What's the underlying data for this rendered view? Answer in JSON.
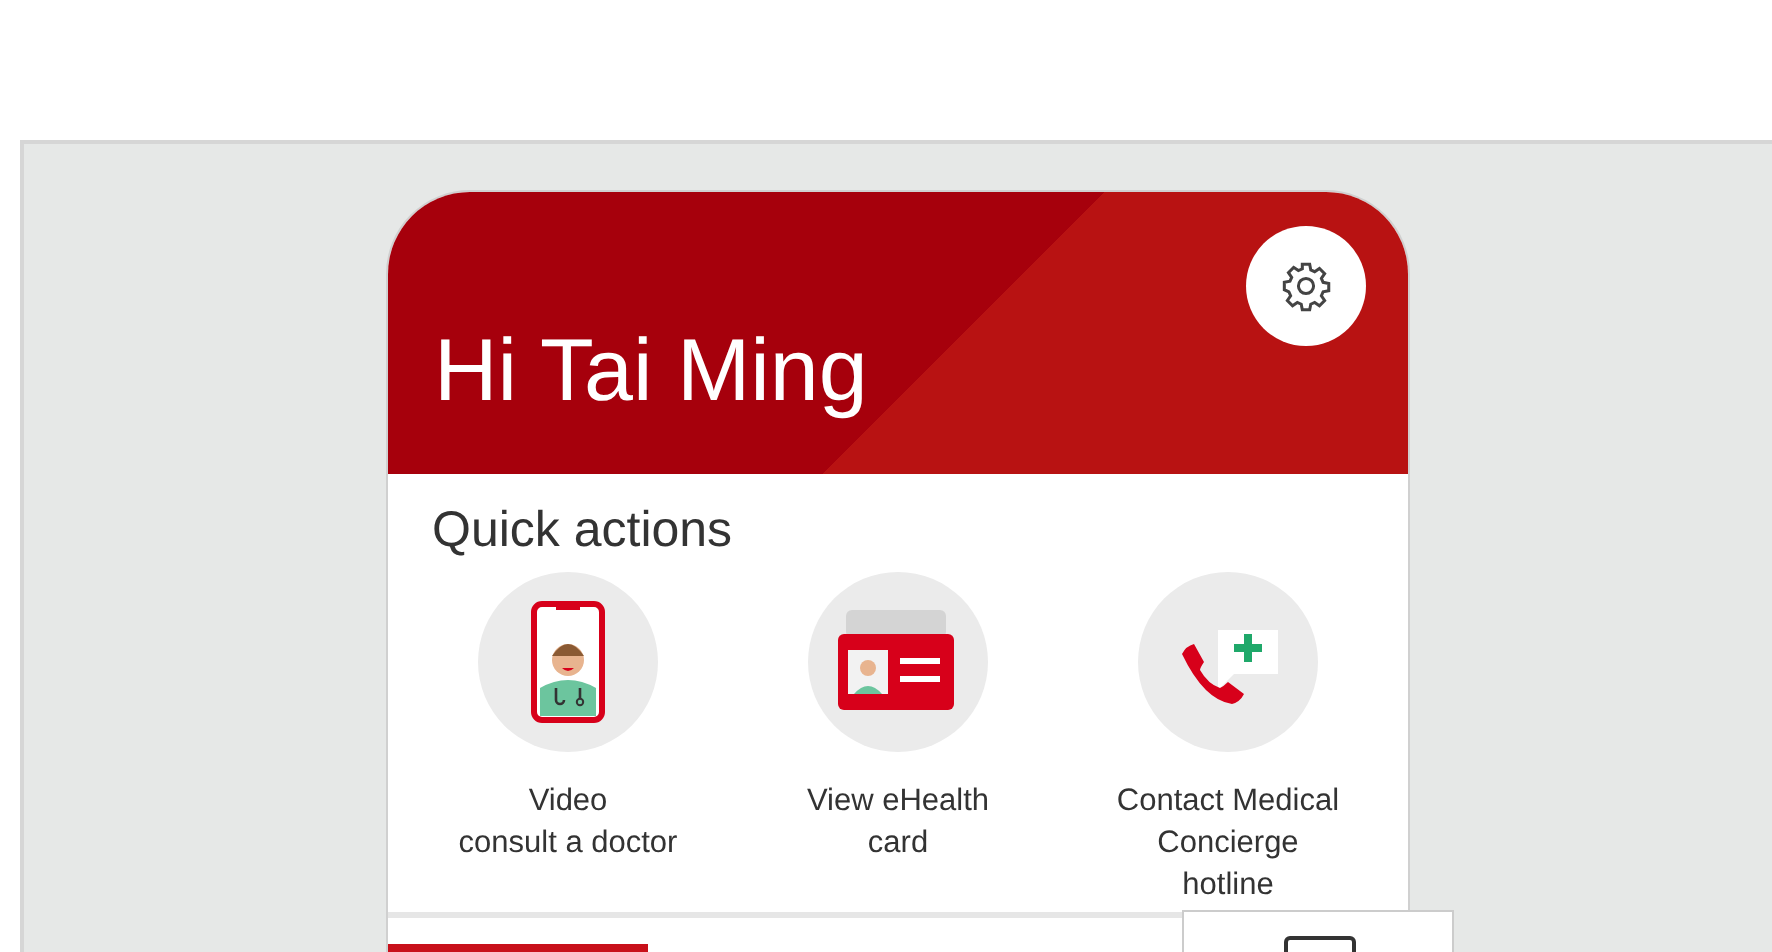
{
  "header": {
    "greeting": "Hi Tai Ming"
  },
  "quick_actions": {
    "title": "Quick actions",
    "items": [
      {
        "kind": "video",
        "label": "Video\nconsult a doctor"
      },
      {
        "kind": "card",
        "label": "View eHealth\ncard"
      },
      {
        "kind": "hotline",
        "label": "Contact Medical\nConcierge\nhotline"
      }
    ]
  }
}
